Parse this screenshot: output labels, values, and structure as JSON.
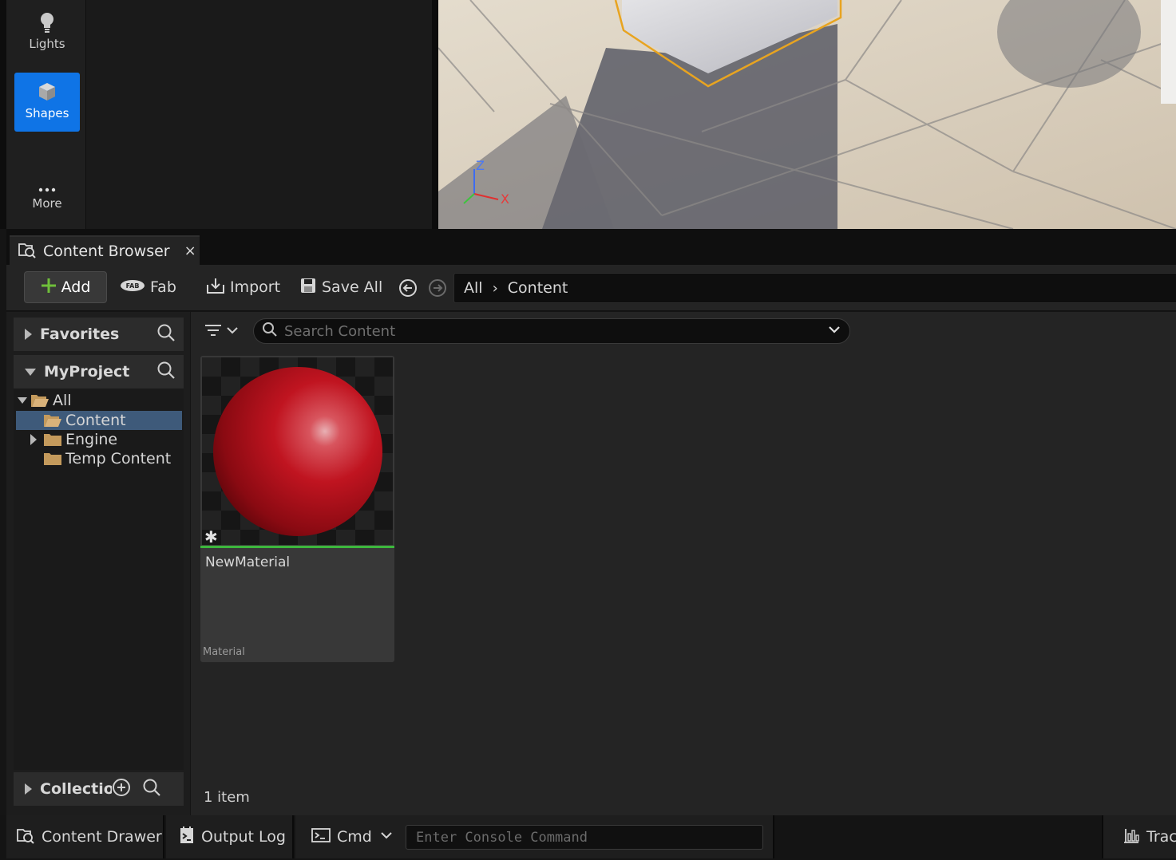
{
  "place_actors": {
    "categories": [
      {
        "label": "Lights",
        "icon": "lightbulb-icon"
      },
      {
        "label": "Shapes",
        "icon": "cube-icon",
        "selected": true
      },
      {
        "label": "More",
        "icon": "ellipsis-icon"
      }
    ]
  },
  "viewport": {
    "axis_labels": {
      "z": "Z",
      "x": "X"
    }
  },
  "content_browser": {
    "tab_title": "Content Browser",
    "tab_close": "×",
    "toolbar": {
      "add_label": "Add",
      "fab_label": "Fab",
      "import_label": "Import",
      "save_all_label": "Save All"
    },
    "breadcrumb": [
      "All",
      "Content"
    ],
    "breadcrumb_sep": "›",
    "sources": {
      "favorites_label": "Favorites",
      "project_label": "MyProject",
      "collections_label": "Collection",
      "tree": [
        {
          "label": "All",
          "expanded": true
        },
        {
          "label": "Content",
          "selected": true
        },
        {
          "label": "Engine",
          "expandable": true
        },
        {
          "label": "Temp Content"
        }
      ]
    },
    "search": {
      "placeholder": "Search Content",
      "value": ""
    },
    "assets": [
      {
        "name": "NewMaterial",
        "type": "Material",
        "accent": "#3db83d"
      }
    ],
    "item_count": "1 item"
  },
  "status_bar": {
    "content_drawer_label": "Content Drawer",
    "output_log_label": "Output Log",
    "cmd_label": "Cmd",
    "console_placeholder": "Enter Console Command",
    "trace_label": "Trace"
  },
  "colors": {
    "accent_blue": "#0f74e6",
    "selection": "#3e5a7a",
    "folder": "#c49a5c",
    "material_red": "#b8101c",
    "add_green": "#6fbf3a"
  }
}
